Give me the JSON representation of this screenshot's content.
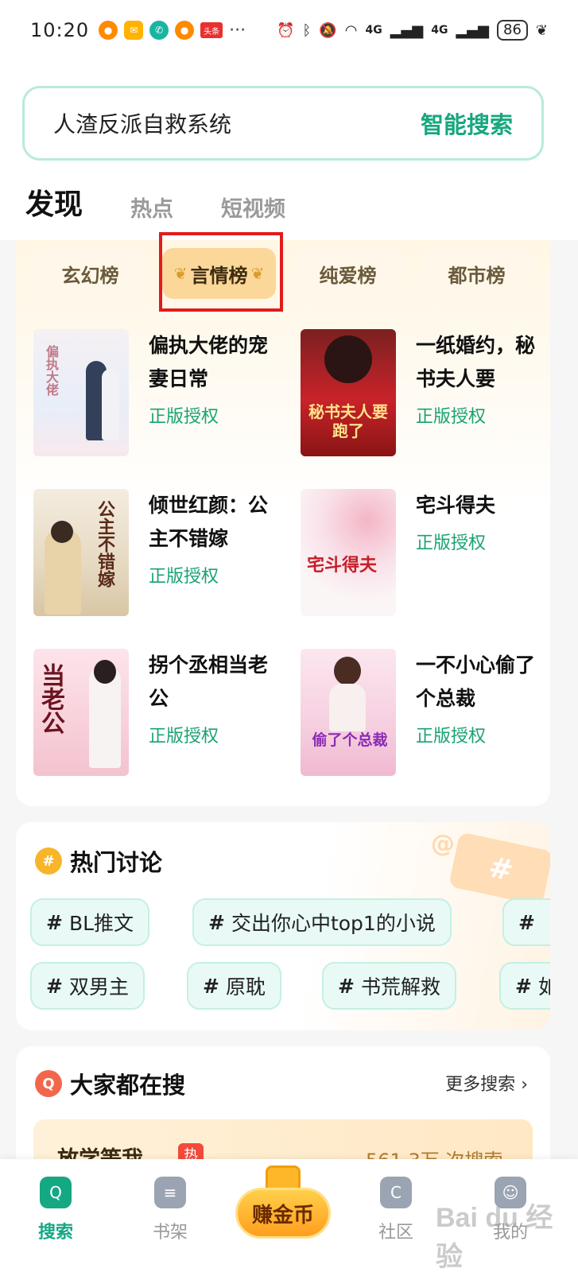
{
  "status_bar": {
    "time": "10:20",
    "notification_icons": [
      "weibo-icon",
      "mail-icon",
      "phone-icon",
      "weibo-icon"
    ],
    "toutiao_label": "头条",
    "more": "···",
    "network_1": "4G",
    "network_2": "4G",
    "battery": "86"
  },
  "search": {
    "query": "人渣反派自救系统",
    "button": "智能搜索"
  },
  "tabs": [
    "发现",
    "热点",
    "短视频"
  ],
  "rank_tabs": [
    "玄幻榜",
    "言情榜",
    "纯爱榜",
    "都市榜"
  ],
  "rank_tab_active": "言情榜",
  "books": [
    {
      "title": "偏执大佬的宠妻日常",
      "tag": "正版授权",
      "cover_text": "偏执大佬"
    },
    {
      "title": "一纸婚约，秘书夫人要",
      "tag": "正版授权",
      "cover_text": "秘书夫人要跑了"
    },
    {
      "title": "倾世红颜：公主不错嫁",
      "tag": "正版授权",
      "cover_text": "公主不错嫁"
    },
    {
      "title": "宅斗得夫",
      "tag": "正版授权",
      "cover_text": "宅斗得夫"
    },
    {
      "title": "拐个丞相当老公",
      "tag": "正版授权",
      "cover_text": "当老公"
    },
    {
      "title": "一不小心偷了个总裁",
      "tag": "正版授权",
      "cover_text": "偷了个总裁"
    }
  ],
  "hot_topics": {
    "title": "热门讨论",
    "chips": [
      "BL推文",
      "交出你心中top1的小说",
      "",
      "双男主",
      "原耽",
      "书荒解救",
      "如"
    ]
  },
  "everyone_search": {
    "title": "大家都在搜",
    "more": "更多搜索",
    "top_item": {
      "name": "放学等我",
      "badge": "热",
      "count": "561.3万 次搜索"
    }
  },
  "bottom_nav": {
    "items": [
      "搜索",
      "书架",
      "社区",
      "我的"
    ],
    "earn": "赚金币"
  },
  "watermark": "Bai du 经验",
  "colors": {
    "accent": "#14a883",
    "highlight": "#e21b1b"
  }
}
